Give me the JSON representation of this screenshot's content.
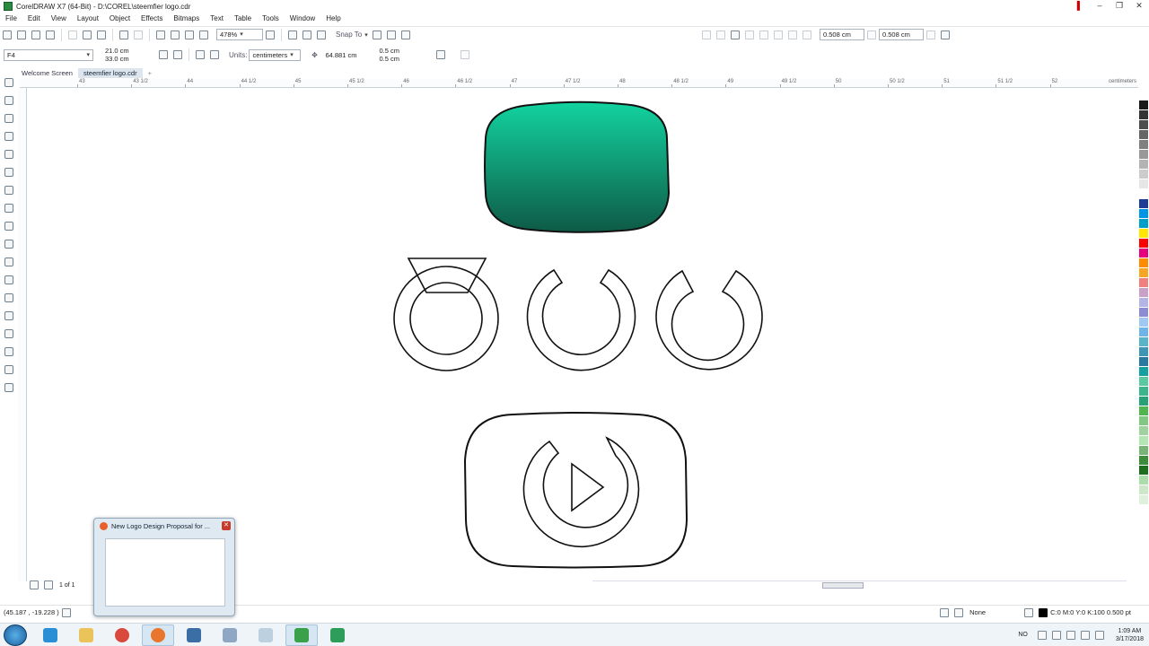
{
  "window": {
    "title": "CorelDRAW X7 (64-Bit) - D:\\COREL\\steemfier logo.cdr"
  },
  "menu": [
    "File",
    "Edit",
    "View",
    "Layout",
    "Object",
    "Effects",
    "Bitmaps",
    "Text",
    "Table",
    "Tools",
    "Window",
    "Help"
  ],
  "toolbar1": {
    "zoom": "478%",
    "snap_to": "Snap To",
    "nudge_x": "0.508 cm",
    "nudge_y": "0.508 cm"
  },
  "toolbar2": {
    "page_preset": "F4",
    "page_width": "21.0 cm",
    "page_height": "33.0 cm",
    "units_label": "Units:",
    "units_value": "centimeters",
    "nudge": "64.881 cm",
    "dup_x": "0.5 cm",
    "dup_y": "0.5 cm"
  },
  "tabs": [
    {
      "label": "Welcome Screen"
    },
    {
      "label": "steemfier logo.cdr"
    }
  ],
  "ruler": {
    "labels": [
      "43",
      "43 1/2",
      "44",
      "44 1/2",
      "45",
      "45 1/2",
      "46",
      "46 1/2",
      "47",
      "47 1/2",
      "48",
      "48 1/2",
      "49",
      "49 1/2",
      "50",
      "50 1/2",
      "51",
      "51 1/2",
      "52"
    ],
    "unit": "centimeters"
  },
  "page_nav": {
    "label": "1 of 1"
  },
  "status": {
    "coords": "(45.187 , -19.228 )",
    "fill": "None",
    "outline": "C:0 M:0 Y:0 K:100  0.500 pt"
  },
  "taskbar": {
    "lang": "NO",
    "time": "1:09 AM",
    "date": "3/17/2018"
  },
  "thumbnail": {
    "title": "New Logo Design Proposal for ..."
  },
  "colors": {
    "gradient_top": "#12d3a0",
    "gradient_bottom": "#0e5a46",
    "outline": "#111111"
  },
  "palette": [
    "#1a1a1a",
    "#333333",
    "#4d4d4d",
    "#666666",
    "#808080",
    "#999999",
    "#b3b3b3",
    "#cccccc",
    "#e6e6e6",
    "#ffffff",
    "#1e3c96",
    "#0096e6",
    "#00a0c8",
    "#ffe600",
    "#ff0000",
    "#e6007e",
    "#ff8c00",
    "#f5a623",
    "#f08080",
    "#c8a0c8",
    "#b4b4e6",
    "#8c8cd2",
    "#a0c8f0",
    "#6eb4e6",
    "#5ab4c8",
    "#3c96b4",
    "#2878a0",
    "#14a0a0",
    "#5ac8a0",
    "#3cb48c",
    "#28a078",
    "#50b450",
    "#82c882",
    "#a0d2a0",
    "#b4e6b4",
    "#78b478",
    "#3c8c3c",
    "#1e6e1e",
    "#aaddaa",
    "#cde8c8",
    "#dff0dd"
  ]
}
